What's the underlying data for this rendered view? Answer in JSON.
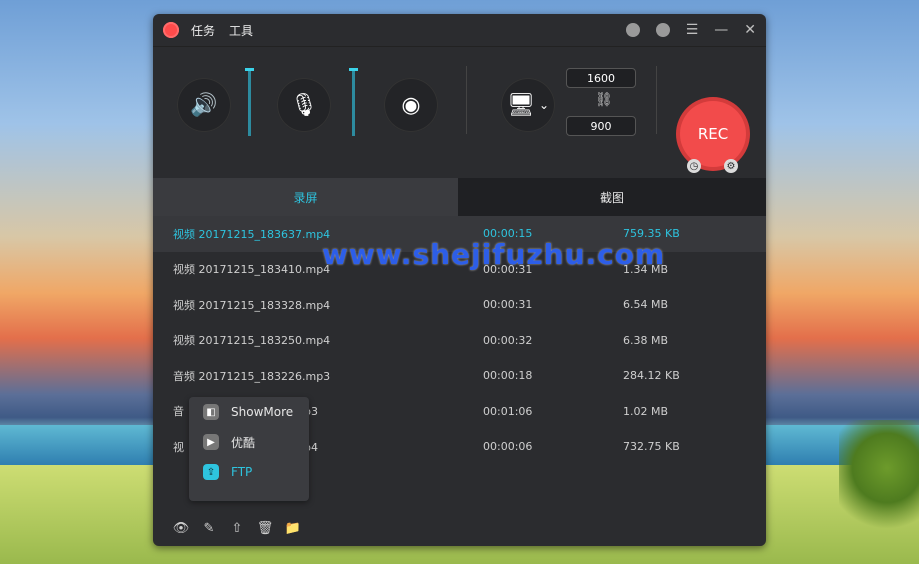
{
  "titlebar": {
    "menus": [
      "任务",
      "工具"
    ]
  },
  "controls": {
    "width": "1600",
    "height": "900",
    "rec_label": "REC"
  },
  "tabs": {
    "record": "录屏",
    "screenshot": "截图"
  },
  "files": [
    {
      "name": "视频 20171215_183637.mp4",
      "duration": "00:00:15",
      "size": "759.35 KB",
      "selected": true
    },
    {
      "name": "视频 20171215_183410.mp4",
      "duration": "00:00:31",
      "size": "1.34 MB"
    },
    {
      "name": "视频 20171215_183328.mp4",
      "duration": "00:00:31",
      "size": "6.54 MB"
    },
    {
      "name": "视频 20171215_183250.mp4",
      "duration": "00:00:32",
      "size": "6.38 MB"
    },
    {
      "name": "音频 20171215_183226.mp3",
      "duration": "00:00:18",
      "size": "284.12 KB"
    },
    {
      "name": "音",
      "name_tail": "p3",
      "duration": "00:01:06",
      "size": "1.02 MB"
    },
    {
      "name": "视",
      "name_tail": "p4",
      "duration": "00:00:06",
      "size": "732.75 KB"
    }
  ],
  "popup_menu": {
    "items": [
      "ShowMore",
      "优酷",
      "FTP"
    ]
  },
  "watermark": "www.shejifuzhu.com",
  "colors": {
    "accent": "#2ec4df",
    "rec_red": "#f24b4b",
    "bg_dark": "#2b2c2f"
  },
  "icons": {
    "bottom": [
      "eye-icon",
      "brush-icon",
      "upload-icon",
      "trash-icon",
      "folder-icon"
    ]
  }
}
